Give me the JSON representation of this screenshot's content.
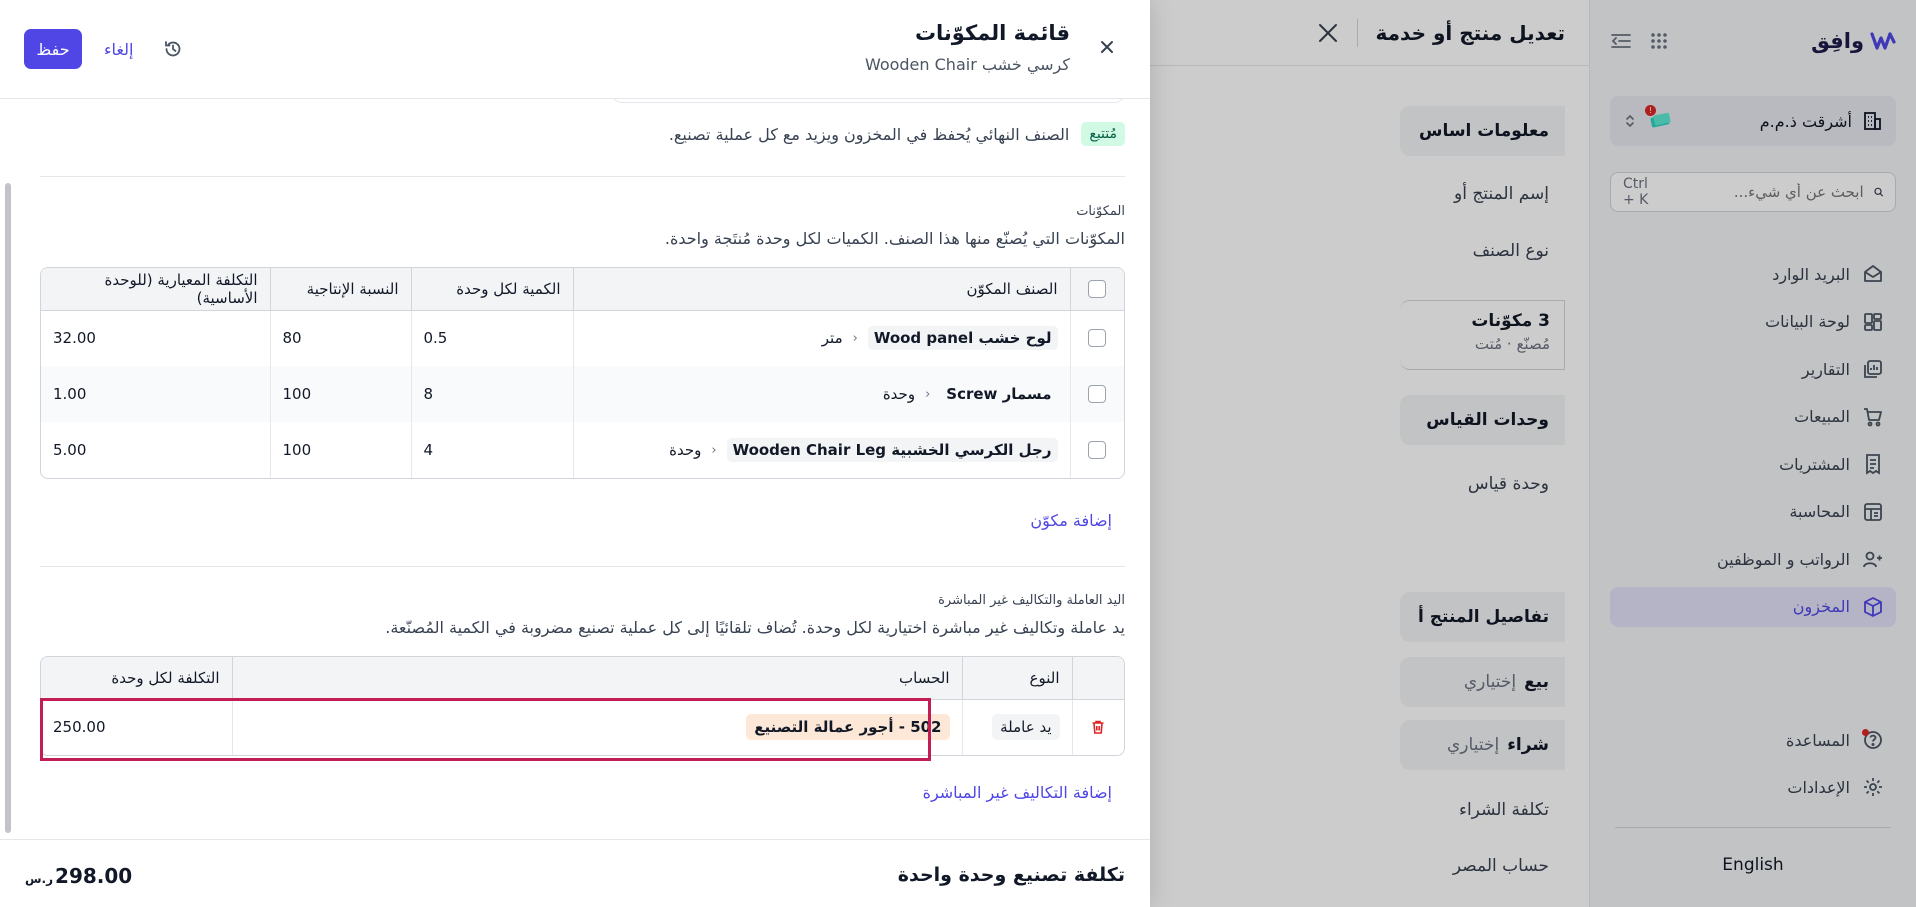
{
  "sidebar": {
    "logo_text": "وافِق",
    "org_name": "أشرقت ذ.م.م",
    "org_notification": "!",
    "search_placeholder": "ابحث عن أي شيء...",
    "search_shortcut": "Ctrl + K",
    "nav": [
      {
        "label": "البريد الوارد",
        "icon": "inbox-icon"
      },
      {
        "label": "لوحة البيانات",
        "icon": "dashboard-icon"
      },
      {
        "label": "التقارير",
        "icon": "reports-icon"
      },
      {
        "label": "المبيعات",
        "icon": "cart-icon"
      },
      {
        "label": "المشتريات",
        "icon": "receipt-icon"
      },
      {
        "label": "المحاسبة",
        "icon": "ledger-icon"
      },
      {
        "label": "الرواتب و الموظفين",
        "icon": "users-icon"
      },
      {
        "label": "المخزون",
        "icon": "box-icon",
        "active": true
      }
    ],
    "help_label": "المساعدة",
    "settings_label": "الإعدادات",
    "language": "English"
  },
  "middle_panel": {
    "title": "تعديل منتج أو خدمة",
    "section_basic": "معلومات اساس",
    "label_name": "إسم المنتج أو",
    "label_type": "نوع الصنف",
    "components_count": "3 مكوّنات",
    "components_meta": "مُصنّع · مُتت",
    "section_units": "وحدات القياس",
    "label_unit": "وحدة قياس",
    "section_details": "تفاصيل المنتج أ",
    "sell_label": "بيع",
    "sell_value": "إختياري",
    "buy_label": "شراء",
    "buy_value": "إختياري",
    "purchase_cost": "تكلفة الشراء",
    "expense_account": "حساب المصر"
  },
  "drawer": {
    "title": "قائمة المكوّنات",
    "subtitle": "كرسي خشب Wooden Chair",
    "save": "حفظ",
    "cancel": "إلغاء",
    "tracked_badge": "مُتتبع",
    "tracked_text": "الصنف النهائي يُحفظ في المخزون ويزيد مع كل عملية تصنيع.",
    "components": {
      "heading": "المكوّنات",
      "description": "المكوّنات التي يُصنّع منها هذا الصنف. الكميات لكل وحدة مُنتَجة واحدة.",
      "columns": [
        "الصنف المكوّن",
        "الكمية لكل وحدة",
        "النسبة الإنتاجية",
        "التكلفة المعيارية (للوحدة الأساسية)"
      ],
      "rows": [
        {
          "name": "لوح خشب Wood panel",
          "unit": "متر",
          "qty": "0.5",
          "yield": "80",
          "cost": "32.00"
        },
        {
          "name": "مسمار Screw",
          "unit": "وحدة",
          "qty": "8",
          "yield": "100",
          "cost": "1.00"
        },
        {
          "name": "رجل الكرسي الخشبية Wooden Chair Leg",
          "unit": "وحدة",
          "qty": "4",
          "yield": "100",
          "cost": "5.00"
        }
      ],
      "add_link": "إضافة مكوّن"
    },
    "labor": {
      "heading": "اليد العاملة والتكاليف غير المباشرة",
      "description": "يد عاملة وتكاليف غير مباشرة اختيارية لكل وحدة. تُضاف تلقائيًا إلى كل عملية تصنيع مضروبة في الكمية المُصنّعة.",
      "columns": [
        "النوع",
        "الحساب",
        "التكلفة لكل وحدة"
      ],
      "rows": [
        {
          "type": "يد عاملة",
          "account": "502 - أجور عمالة التصنيع",
          "cost": "250.00"
        }
      ],
      "add_link": "إضافة التكاليف غير المباشرة"
    },
    "footer": {
      "label": "تكلفة تصنيع وحدة واحدة",
      "total": "298.00",
      "currency": "ر.س"
    }
  }
}
